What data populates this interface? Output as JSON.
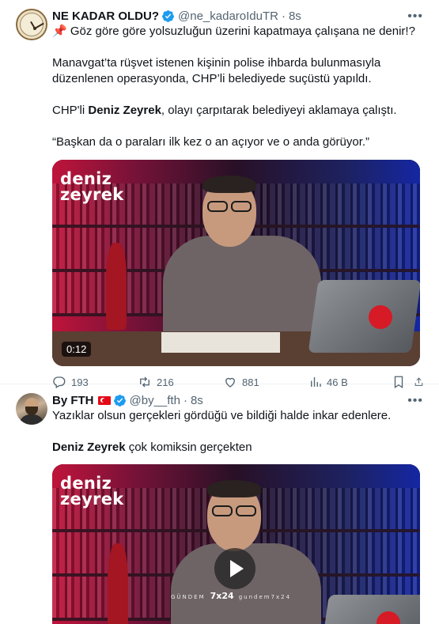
{
  "tweets": [
    {
      "author": {
        "name": "NE KADAR OLDU?",
        "handle": "@ne_kadaroldu TR",
        "handle_display": "@ne_kadaroIduTR",
        "time": "8s",
        "verified": true
      },
      "paragraphs": [
        "📌 Göz göre göre yolsuzluğun üzerini kapatmaya çalışana ne denir!?",
        "Manavgat’ta rüşvet istenen kişinin polise ihbarda bulunmasıyla düzenlenen operasyonda, CHP’li belediyede suçüstü yapıldı.",
        {
          "pre": "CHP'li ",
          "bold": "Deniz Zeyrek",
          "post": ", olayı çarpıtarak belediyeyi aklamaya çalıştı."
        },
        "“Başkan da o paraları ilk kez o an açıyor ve o anda görüyor.”"
      ],
      "media": {
        "brand_line1": "deniz",
        "brand_line2": "zeyrek",
        "duration": "0:12"
      },
      "stats": {
        "replies": "193",
        "reposts": "216",
        "likes": "881",
        "views": "46 B"
      }
    },
    {
      "author": {
        "name": "By FTH",
        "handle_display": "@by__fth",
        "time": "8s",
        "verified": true,
        "flag": "turkey-flag"
      },
      "paragraphs": [
        "Yazıklar olsun gerçekleri gördüğü ve bildiği halde inkar edenlere.",
        {
          "pre": "",
          "bold": "Deniz Zeyrek",
          "post": " çok komiksin gerçekten"
        }
      ],
      "media": {
        "brand_line1": "deniz",
        "brand_line2": "zeyrek",
        "ticker_left": "GÜNDEM",
        "ticker_logo": "7x24",
        "ticker_right": "gundem7x24"
      }
    }
  ],
  "icons": {
    "more": "more-horizontal-icon",
    "reply": "reply-icon",
    "repost": "repost-icon",
    "like": "heart-icon",
    "views": "views-icon",
    "bookmark": "bookmark-icon",
    "share": "share-icon",
    "verified": "verified-badge-icon",
    "play": "play-icon"
  },
  "colors": {
    "verified": "#1d9bf0",
    "secondary_text": "#536471",
    "flag_red": "#e30a17"
  }
}
